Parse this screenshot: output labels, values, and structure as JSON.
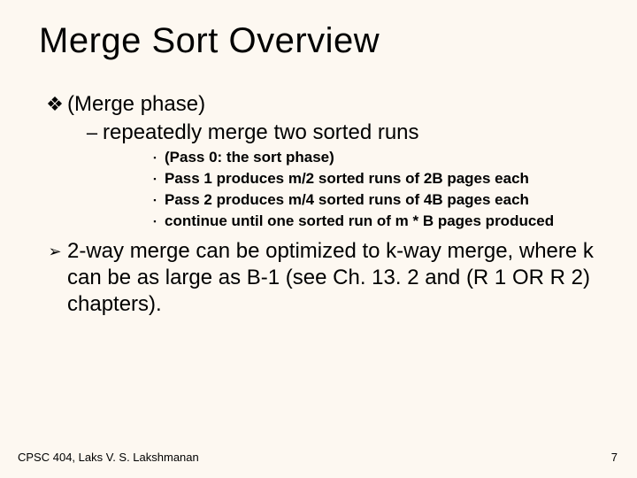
{
  "title": "Merge Sort Overview",
  "pointA": {
    "text": "(Merge  phase)",
    "sub": "repeatedly merge two sorted runs",
    "items": [
      "(Pass 0: the sort phase)",
      "Pass 1 produces  m/2  sorted runs of  2B pages each",
      "Pass 2 produces  m/4  sorted runs of  4B  pages each",
      "continue until one sorted run of  m * B  pages produced"
    ]
  },
  "pointB": "2-way merge can be optimized to k-way merge, where k can be as large as B-1 (see Ch. 13. 2 and (R 1 OR R 2) chapters).",
  "footer": {
    "left": "CPSC 404, Laks V. S. Lakshmanan",
    "right": "7"
  },
  "glyphs": {
    "diamond": "❖",
    "dash": "–",
    "square": "▪",
    "arrow": "➢"
  }
}
